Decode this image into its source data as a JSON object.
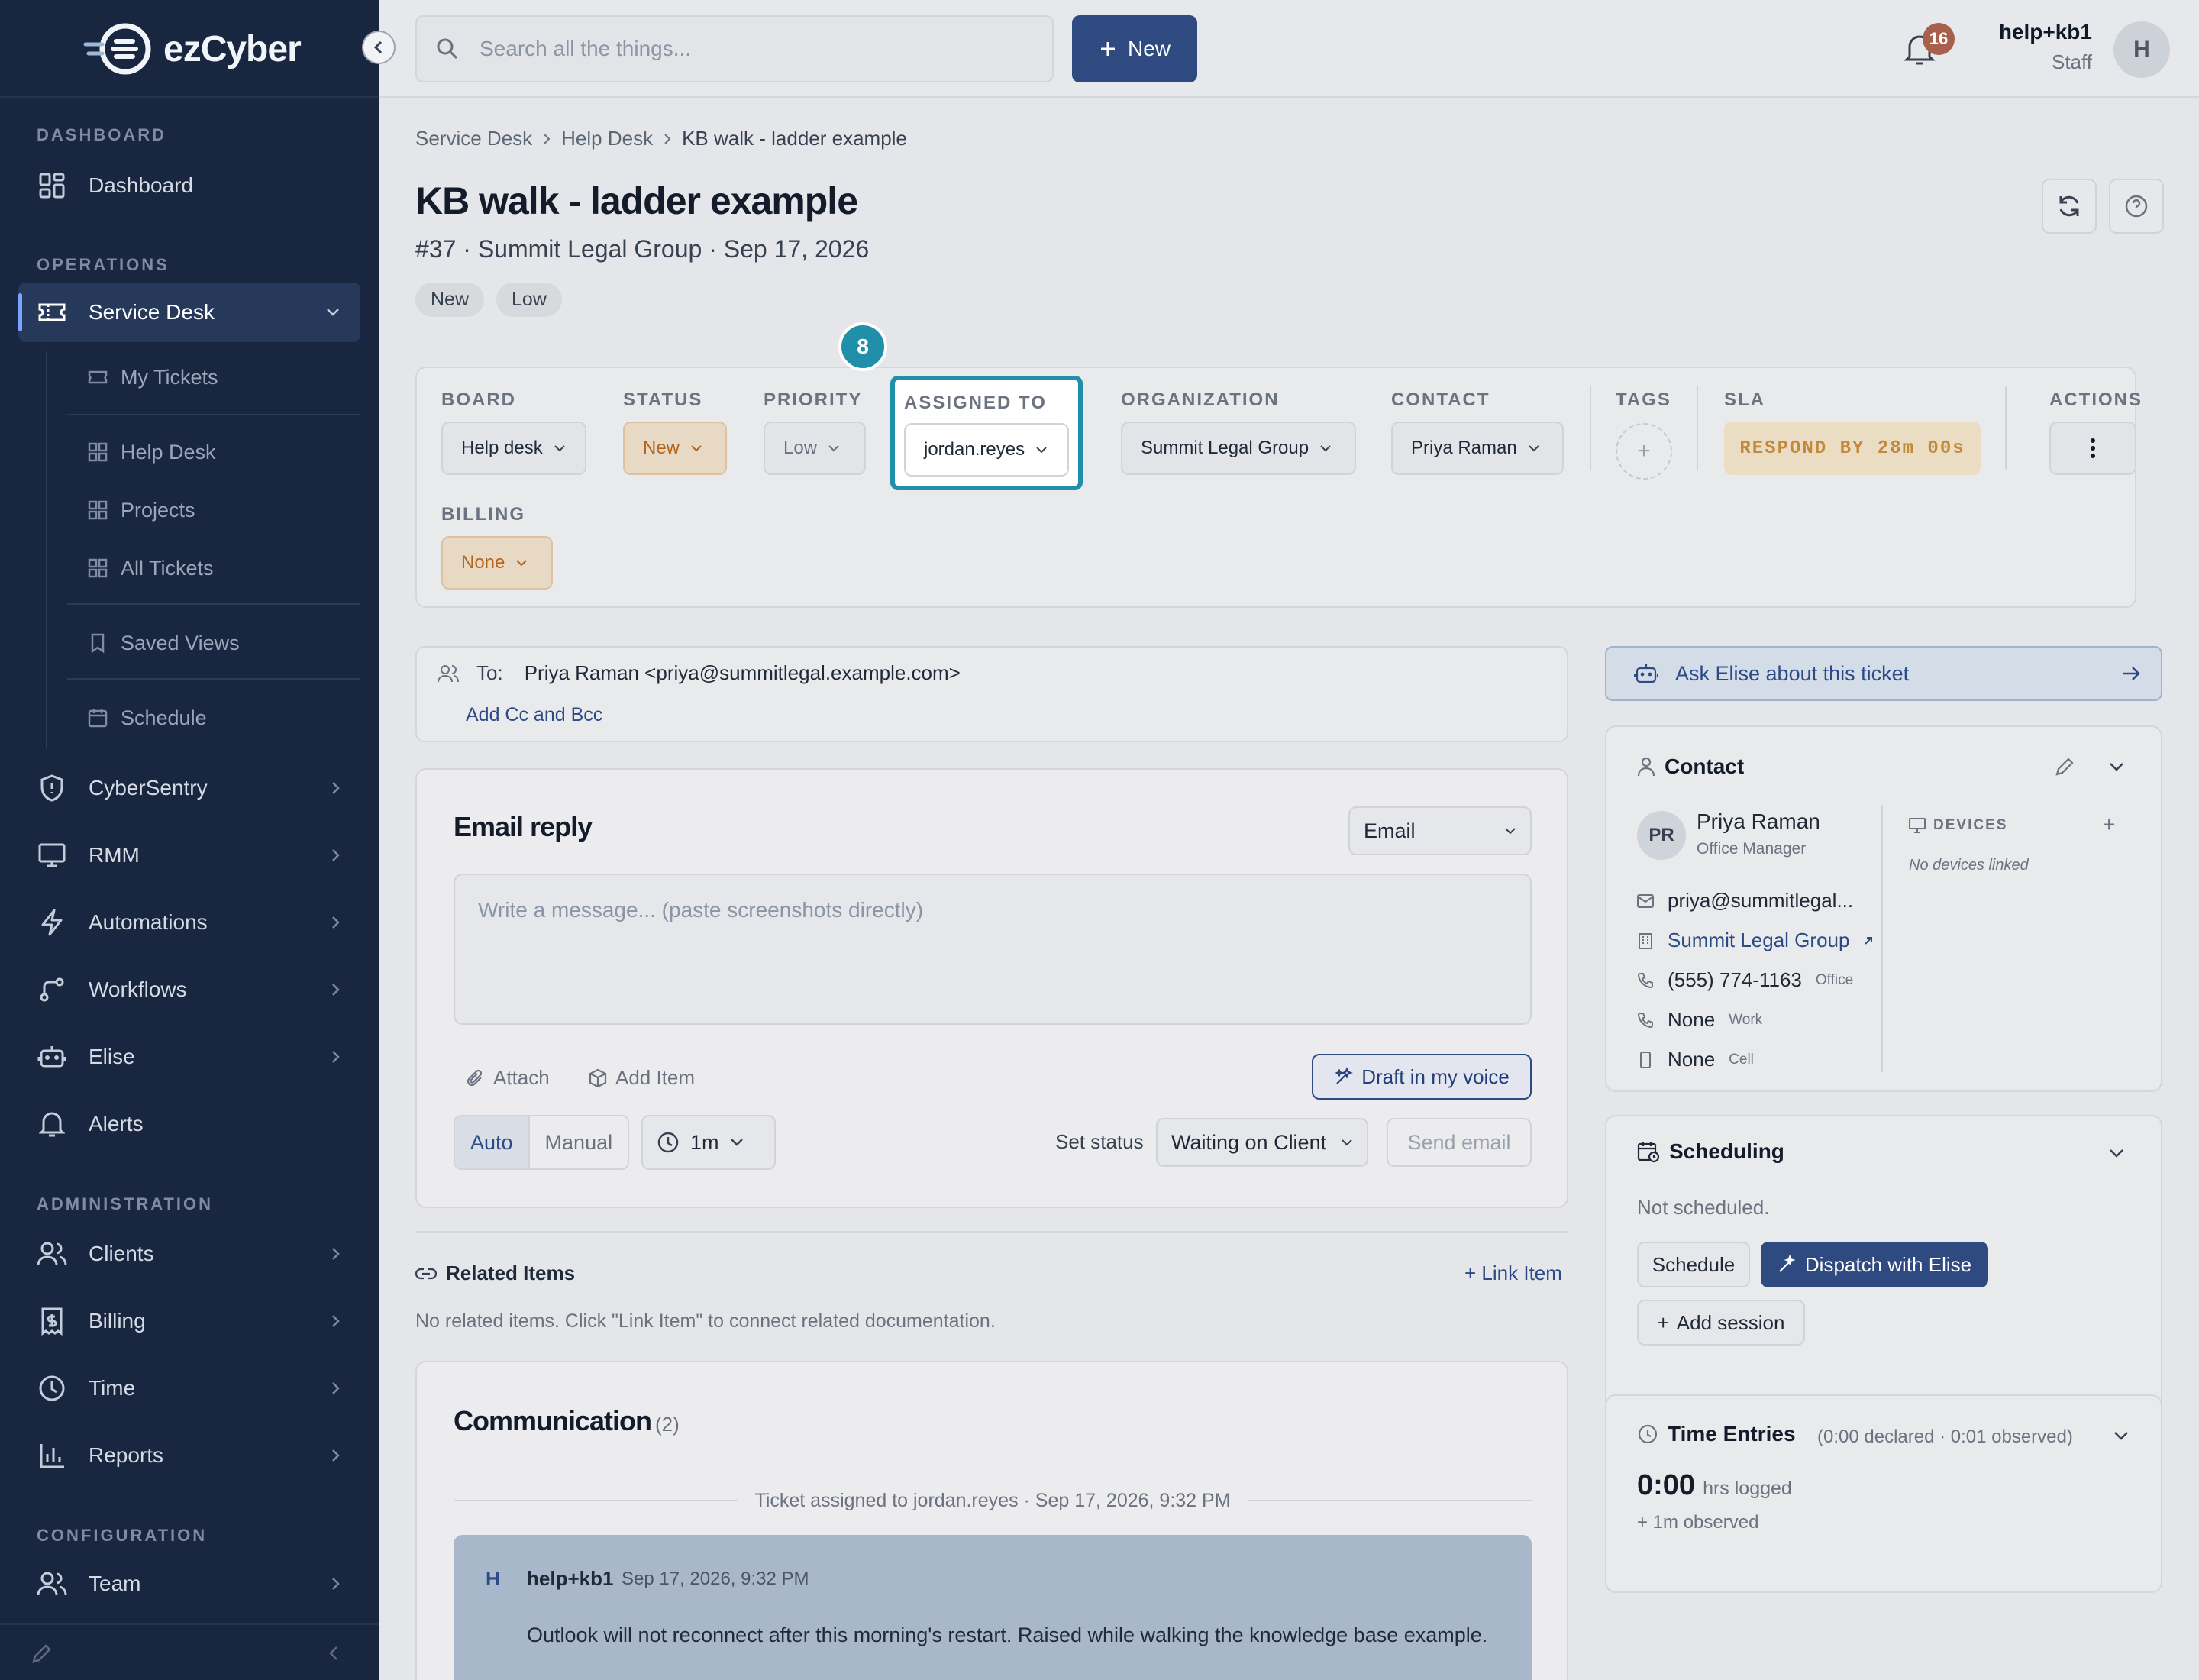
{
  "app": {
    "brand": "ezCyber"
  },
  "sidebar": {
    "sections": {
      "dashboard": "DASHBOARD",
      "operations": "OPERATIONS",
      "administration": "ADMINISTRATION",
      "configuration": "CONFIGURATION"
    },
    "dashboard": "Dashboard",
    "service_desk": "Service Desk",
    "sub_items": [
      "My Tickets",
      "Help Desk",
      "Projects",
      "All Tickets",
      "Saved Views",
      "Schedule"
    ],
    "ops_items": [
      "CyberSentry",
      "RMM",
      "Automations",
      "Workflows",
      "Elise",
      "Alerts"
    ],
    "admin_items": [
      "Clients",
      "Billing",
      "Time",
      "Reports"
    ],
    "config_items": [
      "Team"
    ]
  },
  "topbar": {
    "search_placeholder": "Search all the things...",
    "new_label": "New",
    "notifications": "16",
    "user_name": "help+kb1",
    "user_role": "Staff",
    "avatar": "H"
  },
  "ticket": {
    "breadcrumb": [
      "Service Desk",
      "Help Desk",
      "KB walk - ladder example"
    ],
    "title": "KB walk - ladder example",
    "subtitle": "#37 · Summit Legal Group · Sep 17, 2026",
    "pills": [
      "New",
      "Low"
    ],
    "step_badge": "8"
  },
  "fields": {
    "board": {
      "label": "BOARD",
      "value": "Help desk"
    },
    "status": {
      "label": "STATUS",
      "value": "New"
    },
    "priority": {
      "label": "PRIORITY",
      "value": "Low"
    },
    "assigned": {
      "label": "ASSIGNED TO",
      "value": "jordan.reyes"
    },
    "organization": {
      "label": "ORGANIZATION",
      "value": "Summit Legal Group"
    },
    "contact": {
      "label": "CONTACT",
      "value": "Priya Raman"
    },
    "tags": {
      "label": "TAGS"
    },
    "sla": {
      "label": "SLA",
      "value": "RESPOND BY 28m 00s"
    },
    "actions": {
      "label": "ACTIONS"
    },
    "billing": {
      "label": "BILLING",
      "value": "None"
    }
  },
  "compose": {
    "to_label": "To:",
    "to_value": "Priya Raman <priya@summitlegal.example.com>",
    "add_cc": "Add Cc and Bcc",
    "title": "Email reply",
    "channel": "Email",
    "placeholder": "Write a message... (paste screenshots directly)",
    "attach": "Attach",
    "add_item": "Add Item",
    "draft": "Draft in my voice",
    "mode_auto": "Auto",
    "mode_manual": "Manual",
    "timer": "1m",
    "set_status_label": "Set status",
    "set_status_value": "Waiting on Client",
    "send": "Send email"
  },
  "related": {
    "title": "Related Items",
    "link": "Link Item",
    "empty": "No related items. Click \"Link Item\" to connect related documentation."
  },
  "communication": {
    "title": "Communication",
    "count": "(2)",
    "system_line": "Ticket assigned to jordan.reyes · Sep 17, 2026, 9:32 PM",
    "message": {
      "avatar": "H",
      "author": "help+kb1",
      "time": "Sep 17, 2026, 9:32 PM",
      "text": "Outlook will not reconnect after this morning's restart. Raised while walking the knowledge base example."
    }
  },
  "right": {
    "ask": "Ask Elise about this ticket",
    "contact": {
      "title": "Contact",
      "initials": "PR",
      "name": "Priya Raman",
      "role": "Office Manager",
      "email": "priya@summitlegal...",
      "org": "Summit Legal Group",
      "phone": "(555) 774-1163",
      "phone_tag": "Office",
      "work": "None",
      "work_tag": "Work",
      "cell": "None",
      "cell_tag": "Cell",
      "devices_label": "DEVICES",
      "devices_empty": "No devices linked"
    },
    "scheduling": {
      "title": "Scheduling",
      "status": "Not scheduled.",
      "schedule": "Schedule",
      "dispatch": "Dispatch with Elise",
      "add_session": "Add session"
    },
    "time": {
      "title": "Time Entries",
      "summary": "(0:00 declared · 0:01 observed)",
      "logged": "0:00",
      "logged_unit": "hrs logged",
      "observed_line": "+ 1m observed",
      "observed_label": "OBSERVED",
      "observed_value": "0:01"
    }
  },
  "colors": {
    "sidebar": "#18263f",
    "primary": "#2e4a80",
    "highlight": "#1f8faa",
    "sla": "#c28a3a"
  }
}
